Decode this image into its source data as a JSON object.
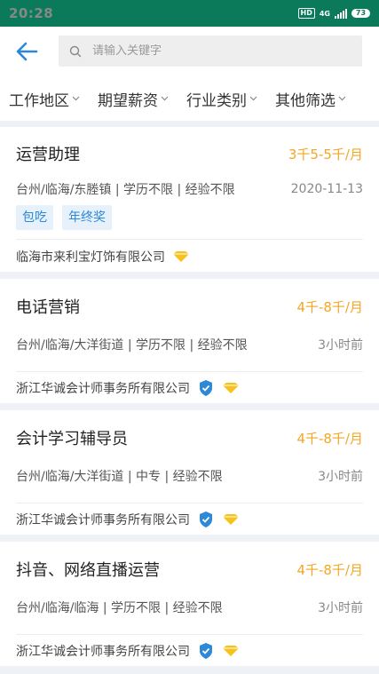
{
  "status_bar": {
    "time": "20:28",
    "hd": "HD",
    "network": "4G",
    "battery": "73"
  },
  "header": {
    "search_placeholder": "请输入关键字"
  },
  "filters": [
    {
      "label": "工作地区"
    },
    {
      "label": "期望薪资"
    },
    {
      "label": "行业类别"
    },
    {
      "label": "其他筛选"
    }
  ],
  "jobs": [
    {
      "title": "运营助理",
      "salary": "3千5-5千/月",
      "details": "台州/临海/东塍镇 | 学历不限 | 经验不限",
      "time": "2020-11-13",
      "tags": [
        "包吃",
        "年终奖"
      ],
      "company": "临海市来利宝灯饰有限公司",
      "icons": [
        "diamond-icon"
      ]
    },
    {
      "title": "电话营销",
      "salary": "4千-8千/月",
      "details": "台州/临海/大洋街道 | 学历不限 | 经验不限",
      "time": "3小时前",
      "tags": [],
      "company": "浙江华诚会计师事务所有限公司",
      "icons": [
        "verified-shield-icon",
        "diamond-icon"
      ]
    },
    {
      "title": "会计学习辅导员",
      "salary": "4千-8千/月",
      "details": "台州/临海/大洋街道 | 中专 | 经验不限",
      "time": "3小时前",
      "tags": [],
      "company": "浙江华诚会计师事务所有限公司",
      "icons": [
        "verified-shield-icon",
        "diamond-icon"
      ]
    },
    {
      "title": "抖音、网络直播运营",
      "salary": "4千-8千/月",
      "details": "台州/临海/临海 | 学历不限 | 经验不限",
      "time": "3小时前",
      "tags": [],
      "company": "浙江华诚会计师事务所有限公司",
      "icons": [
        "verified-shield-icon",
        "diamond-icon"
      ]
    }
  ],
  "colors": {
    "status_bar": "#0b7a5a",
    "accent_blue": "#2d88d8",
    "salary_orange": "#f5a623",
    "diamond_gold": "#f7c21b"
  }
}
